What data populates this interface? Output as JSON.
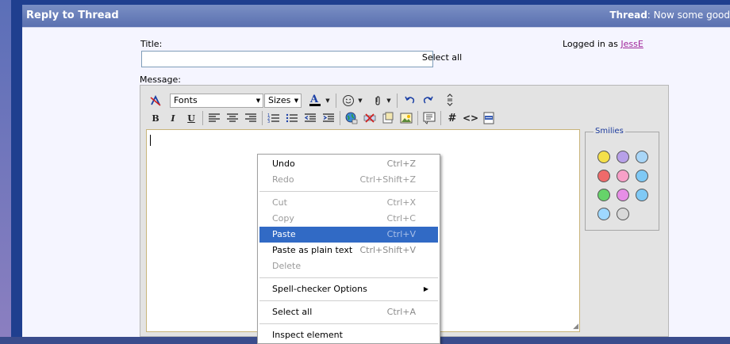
{
  "header": {
    "title": "Reply to Thread",
    "thread_label": "Thread",
    "thread_title": ": Now some good"
  },
  "form": {
    "title_label": "Title:",
    "title_value": "",
    "message_label": "Message:",
    "logged_in_prefix": "Logged in as ",
    "username": "JessE",
    "tooltip": "Select all"
  },
  "toolbar": {
    "font_select": "Fonts",
    "size_select": "Sizes",
    "bold": "B",
    "italic": "I",
    "underline": "U",
    "code": "#",
    "html": "<>"
  },
  "smilies": {
    "legend": "Smilies",
    "items": [
      {
        "name": "smile",
        "color": "#f4e04a"
      },
      {
        "name": "frown",
        "color": "#b7a0e8"
      },
      {
        "name": "confused",
        "color": "#a9d6f7"
      },
      {
        "name": "mad",
        "color": "#ef6a6a"
      },
      {
        "name": "redface",
        "color": "#f7a0c8"
      },
      {
        "name": "wink",
        "color": "#7fc9f5"
      },
      {
        "name": "biggrin",
        "color": "#66d36a"
      },
      {
        "name": "tongue",
        "color": "#e68ee6"
      },
      {
        "name": "rolleyes",
        "color": "#7fc9f5"
      },
      {
        "name": "cool",
        "color": "#9fd8ff"
      },
      {
        "name": "eek",
        "color": "#d9d9d9"
      }
    ]
  },
  "context_menu": {
    "undo": {
      "label": "Undo",
      "shortcut": "Ctrl+Z"
    },
    "redo": {
      "label": "Redo",
      "shortcut": "Ctrl+Shift+Z"
    },
    "cut": {
      "label": "Cut",
      "shortcut": "Ctrl+X"
    },
    "copy": {
      "label": "Copy",
      "shortcut": "Ctrl+C"
    },
    "paste": {
      "label": "Paste",
      "shortcut": "Ctrl+V"
    },
    "paste_plain": {
      "label": "Paste as plain text",
      "shortcut": "Ctrl+Shift+V"
    },
    "delete": {
      "label": "Delete"
    },
    "spell": {
      "label": "Spell-checker Options"
    },
    "select_all": {
      "label": "Select all",
      "shortcut": "Ctrl+A"
    },
    "inspect": {
      "label": "Inspect element"
    }
  }
}
